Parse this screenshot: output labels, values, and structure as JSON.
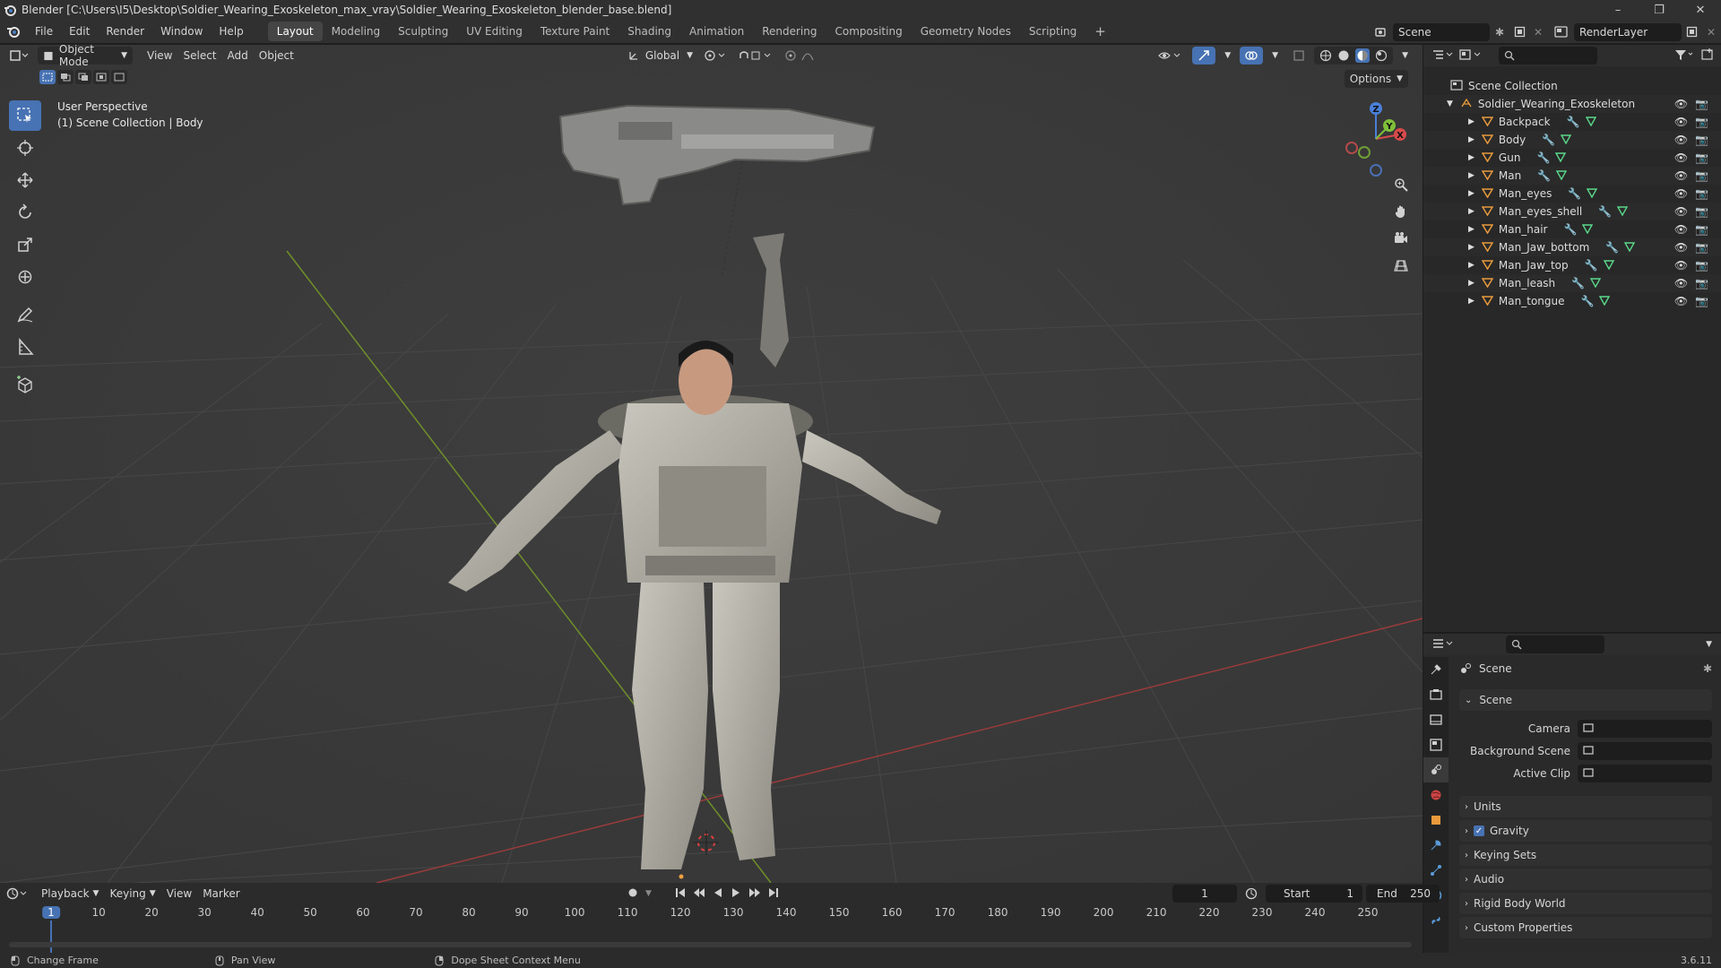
{
  "window": {
    "title": "Blender [C:\\Users\\I5\\Desktop\\Soldier_Wearing_Exoskeleton_max_vray\\Soldier_Wearing_Exoskeleton_blender_base.blend]"
  },
  "menu": [
    "File",
    "Edit",
    "Render",
    "Window",
    "Help"
  ],
  "workspaces": [
    "Layout",
    "Modeling",
    "Sculpting",
    "UV Editing",
    "Texture Paint",
    "Shading",
    "Animation",
    "Rendering",
    "Compositing",
    "Geometry Nodes",
    "Scripting"
  ],
  "active_workspace": "Layout",
  "top_right": {
    "scene": "Scene",
    "view_layer": "RenderLayer"
  },
  "viewport": {
    "mode": "Object Mode",
    "menus": [
      "View",
      "Select",
      "Add",
      "Object"
    ],
    "orientation": "Global",
    "options_label": "Options",
    "overlay_title": "User Perspective",
    "overlay_subtitle": "(1) Scene Collection | Body",
    "gizmo": {
      "z": "Z",
      "y": "Y",
      "x": "X"
    }
  },
  "outliner": {
    "root": "Scene Collection",
    "collection": "Soldier_Wearing_Exoskeleton",
    "objects": [
      "Backpack",
      "Body",
      "Gun",
      "Man",
      "Man_eyes",
      "Man_eyes_shell",
      "Man_hair",
      "Man_Jaw_bottom",
      "Man_Jaw_top",
      "Man_leash",
      "Man_tongue"
    ]
  },
  "properties": {
    "context": "Scene",
    "section": "Scene",
    "fields": [
      {
        "label": "Camera",
        "value": ""
      },
      {
        "label": "Background Scene",
        "value": ""
      },
      {
        "label": "Active Clip",
        "value": ""
      }
    ],
    "panels": [
      {
        "label": "Units",
        "checkbox": false
      },
      {
        "label": "Gravity",
        "checkbox": true
      },
      {
        "label": "Keying Sets",
        "checkbox": false
      },
      {
        "label": "Audio",
        "checkbox": false
      },
      {
        "label": "Rigid Body World",
        "checkbox": false
      },
      {
        "label": "Custom Properties",
        "checkbox": false
      }
    ]
  },
  "timeline": {
    "menus": [
      "Playback",
      "Keying",
      "View",
      "Marker"
    ],
    "current_frame": "1",
    "start_label": "Start",
    "start": "1",
    "end_label": "End",
    "end": "250",
    "ticks": [
      "1",
      "10",
      "20",
      "30",
      "40",
      "50",
      "60",
      "70",
      "80",
      "90",
      "100",
      "110",
      "120",
      "130",
      "140",
      "150",
      "160",
      "170",
      "180",
      "190",
      "200",
      "210",
      "220",
      "230",
      "240",
      "250"
    ]
  },
  "status": {
    "items": [
      "Change Frame",
      "Pan View",
      "Dope Sheet Context Menu"
    ],
    "version": "3.6.11"
  }
}
